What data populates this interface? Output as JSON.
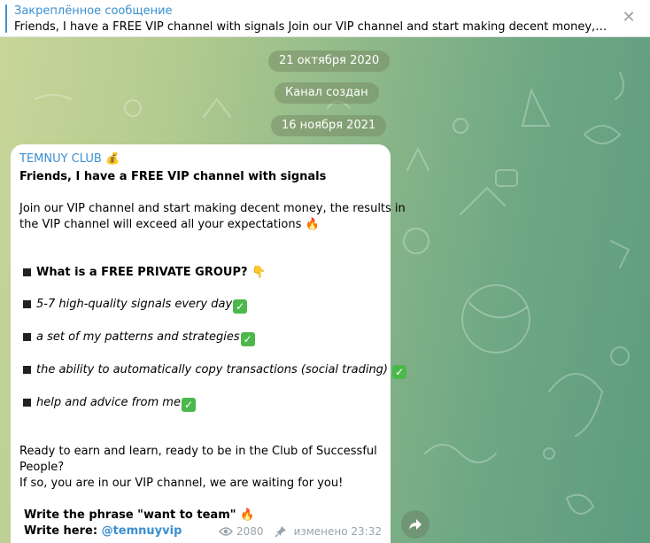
{
  "pinned": {
    "title": "Закреплённое сообщение",
    "text": "Friends, I have a FREE VIP channel with signals   Join our VIP channel and start making decent money, the resul...",
    "close_glyph": "✕"
  },
  "service": {
    "date1": "21 октября 2020",
    "created": "Канал создан",
    "date2": "16 ноября 2021"
  },
  "message": {
    "author": "TEMNUY CLUB",
    "author_emoji": "💰",
    "headline": "Friends, I have a FREE VIP channel with signals",
    "intro1": " Join our VIP channel and start making decent money, the results in",
    "intro2": "the VIP channel will exceed all your expectations",
    "fire": "🔥",
    "point": "👇",
    "check": "✓",
    "q": "What is a FREE PRIVATE GROUP?",
    "items": [
      "5-7 high-quality signals every day",
      "a set of my patterns and strategies",
      "the ability to automatically copy transactions (social trading)",
      "help and advice from me"
    ],
    "outro1": " Ready to earn and learn, ready to be in the Club of Successful",
    "outro2": "People?",
    "outro3": " If so, you are in our VIP channel, we are waiting for you!",
    "cta1": "Write the phrase \"want to team\"",
    "cta2_label": "Write here:",
    "cta2_link": "@temnuyvip",
    "views": "2080",
    "edited": "изменено 23:32"
  },
  "icons": {
    "views": "eye-icon",
    "pin": "pin-icon",
    "forward": "forward-icon",
    "close": "close-icon"
  },
  "colors": {
    "accent": "#3a8fd1",
    "check": "#4cb84c"
  }
}
